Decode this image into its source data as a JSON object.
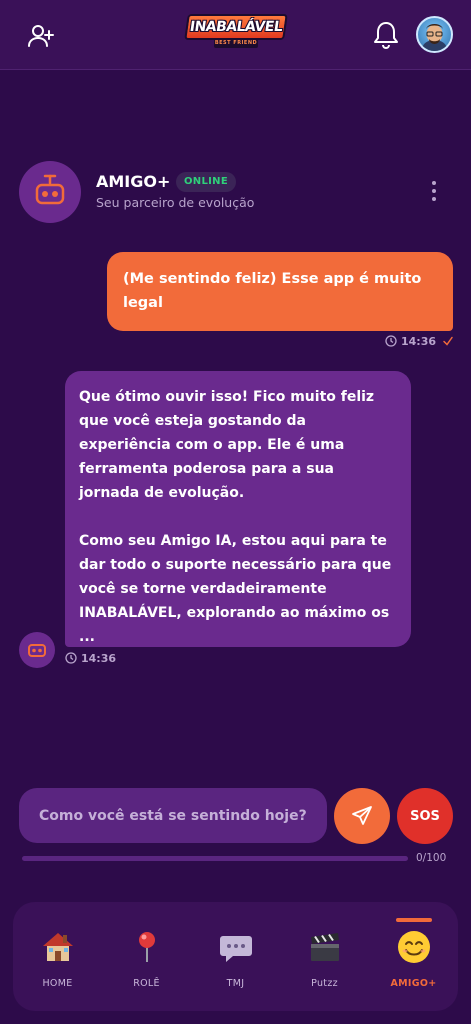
{
  "header": {
    "logo_text": "INABALÁVEL",
    "logo_sub": "BEST FRIEND"
  },
  "bot": {
    "name": "AMIGO+",
    "status": "ONLINE",
    "subtitle": "Seu parceiro de evolução"
  },
  "messages": [
    {
      "from": "user",
      "text": "(Me sentindo feliz) Esse app é muito legal",
      "time": "14:36"
    },
    {
      "from": "bot",
      "paragraphs": [
        "Que ótimo ouvir isso! Fico muito feliz que você esteja gostando da experiência com o app. Ele é uma ferramenta poderosa para a sua jornada de evolução.",
        "Como seu Amigo IA, estou aqui para te dar todo o suporte necessário para que você se torne verdadeiramente INABALÁVEL, explorando ao máximo os ..."
      ],
      "time": "14:36"
    }
  ],
  "composer": {
    "placeholder": "Como você está se sentindo hoje?",
    "sos_label": "SOS",
    "char_count": "0/100",
    "progress": 0
  },
  "nav": {
    "items": [
      {
        "label": "HOME",
        "icon": "house-icon"
      },
      {
        "label": "ROLÊ",
        "icon": "pin-icon"
      },
      {
        "label": "TMJ",
        "icon": "chat-bubble-icon"
      },
      {
        "label": "Putzz",
        "icon": "clapper-icon"
      },
      {
        "label": "AMIGO+",
        "icon": "smiley-icon",
        "active": true
      }
    ]
  },
  "colors": {
    "background": "#2d0b4a",
    "accent": "#f26b3a",
    "bubble_bot": "#6a2a8e",
    "online": "#2fd07a",
    "sos": "#e0302a"
  }
}
